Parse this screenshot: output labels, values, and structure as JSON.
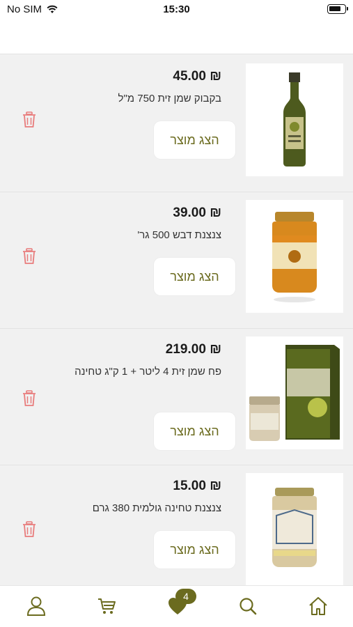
{
  "status_bar": {
    "carrier": "No SIM",
    "time": "15:30"
  },
  "colors": {
    "accent": "#6b6b1f",
    "trash": "#e87b7b"
  },
  "currency_symbol": "₪",
  "button_label": "הצג מוצר",
  "items": [
    {
      "price": "₪ 45.00",
      "title": "בקבוק שמן זית 750 מ\"ל",
      "image": "olive-oil-bottle"
    },
    {
      "price": "₪ 39.00",
      "title": "צנצנת דבש 500 גר'",
      "image": "honey-jar"
    },
    {
      "price": "₪ 219.00",
      "title": "פח שמן זית 4 ליטר + 1 ק\"ג טחינה",
      "image": "olive-oil-tin-and-tahini"
    },
    {
      "price": "₪ 15.00",
      "title": "צנצנת טחינה גולמית 380 גרם",
      "image": "tahini-jar"
    }
  ],
  "bottom_nav": {
    "items": [
      "profile-icon",
      "cart-icon",
      "heart-icon",
      "search-icon",
      "home-icon"
    ],
    "favorites_badge": "4"
  }
}
